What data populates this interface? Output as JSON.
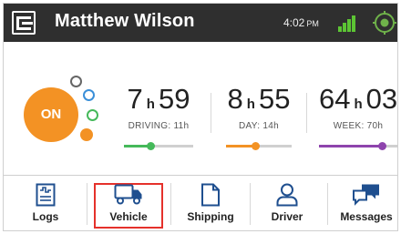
{
  "header": {
    "driver_name": "Matthew Wilson",
    "time": "4:02",
    "ampm": "PM",
    "signal_color": "#5cc534",
    "logo_icon": "eld-logo-icon",
    "gps_icon": "gps-location-icon"
  },
  "status": {
    "duty_status": "ON",
    "duty_color": "#f39224"
  },
  "clocks": [
    {
      "hours": "7",
      "unit": "h",
      "minutes": "59",
      "label": "DRIVING: 11h",
      "color": "#45b95a",
      "progress": 0.38
    },
    {
      "hours": "8",
      "unit": "h",
      "minutes": "55",
      "label": "DAY: 14h",
      "color": "#f39224",
      "progress": 0.45
    },
    {
      "hours": "64",
      "unit": "h",
      "minutes": "03",
      "label": "WEEK: 70h",
      "color": "#8e44ad",
      "progress": 0.8
    }
  ],
  "nav": {
    "items": [
      {
        "label": "Logs",
        "icon": "logbook-icon"
      },
      {
        "label": "Vehicle",
        "icon": "truck-icon"
      },
      {
        "label": "Shipping",
        "icon": "document-icon"
      },
      {
        "label": "Driver",
        "icon": "person-icon"
      },
      {
        "label": "Messages",
        "icon": "chat-icon"
      }
    ],
    "active_index": 1,
    "icon_color": "#1f4f8f",
    "active_border_color": "#e5312b"
  }
}
